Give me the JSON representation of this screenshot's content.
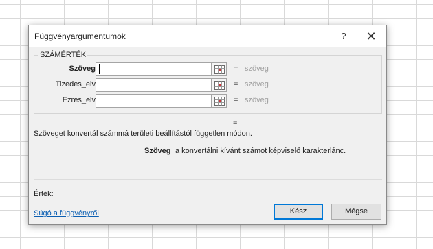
{
  "dialog": {
    "title": "Függvényargumentumok",
    "help_symbol": "?",
    "close_symbol": "✕",
    "function_name": "SZÁMÉRTÉK",
    "arguments": [
      {
        "label": "Szöveg",
        "bold": true,
        "value": "",
        "result": "szöveg"
      },
      {
        "label": "Tizedes_elv",
        "bold": false,
        "value": "",
        "result": "szöveg"
      },
      {
        "label": "Ezres_elv",
        "bold": false,
        "value": "",
        "result": "szöveg"
      }
    ],
    "equals_sign": "=",
    "result_equals": "=",
    "description": "Szöveget konvertál számmá területi beállítástól független módon.",
    "param_name": "Szöveg",
    "param_description": "a konvertálni kívánt számot képviselő karakterlánc.",
    "value_label": "Érték:",
    "help_link": "Súgó a függvényről",
    "ok_label": "Kész",
    "cancel_label": "Mégse"
  },
  "icons": {
    "range_selector": "range-select-icon",
    "close": "close-icon",
    "help": "help-icon"
  },
  "colors": {
    "link": "#0b5fb3",
    "primary_border": "#0078d7",
    "dialog_bg": "#f0f0f0",
    "result_text": "#a0a0a0"
  }
}
